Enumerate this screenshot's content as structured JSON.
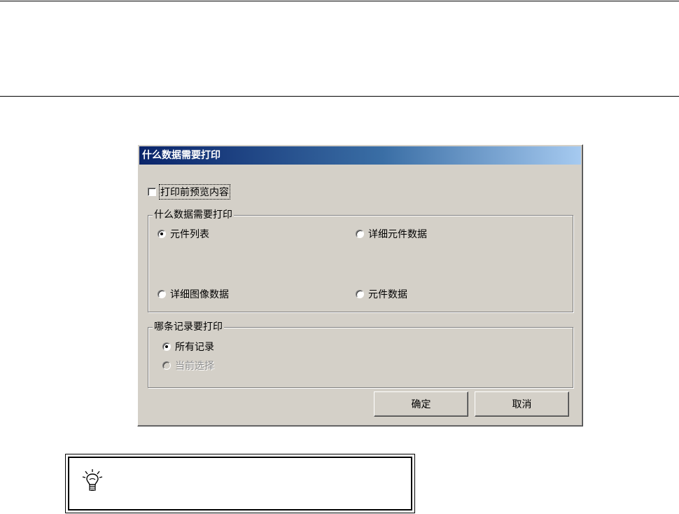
{
  "dialog": {
    "title": "什么数据需要打印",
    "preview_checkbox": {
      "label": "打印前预览内容",
      "checked": false
    },
    "data_group": {
      "legend": "什么数据需要打印",
      "options": [
        {
          "label": "元件列表",
          "selected": true
        },
        {
          "label": "详细元件数据",
          "selected": false
        },
        {
          "label": "详细图像数据",
          "selected": false
        },
        {
          "label": "元件数据",
          "selected": false
        }
      ]
    },
    "records_group": {
      "legend": "哪条记录要打印",
      "options": [
        {
          "label": "所有记录",
          "selected": true,
          "enabled": true
        },
        {
          "label": "当前选择",
          "selected": false,
          "enabled": false
        }
      ]
    },
    "buttons": {
      "ok": "确定",
      "cancel": "取消"
    }
  },
  "tip": {
    "icon": "lightbulb-icon"
  },
  "colors": {
    "dialog_face": "#d4d0c8",
    "titlebar_start": "#0a246a",
    "titlebar_end": "#a6caf0"
  }
}
